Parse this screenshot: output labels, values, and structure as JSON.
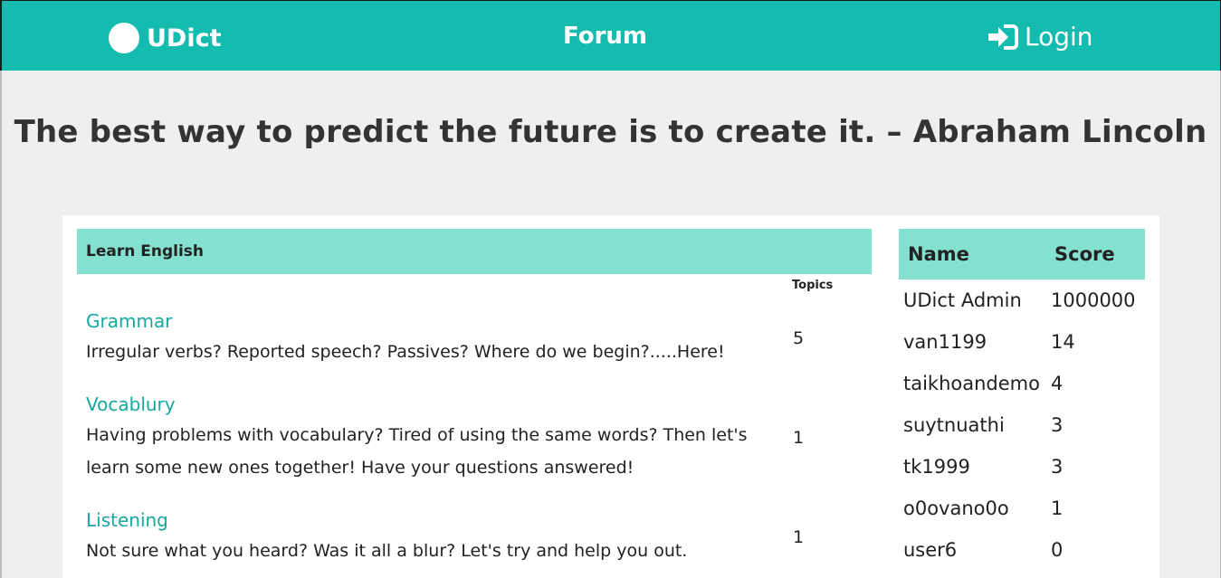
{
  "header": {
    "brand": "UDict",
    "forum_label": "Forum",
    "login_label": "Login"
  },
  "quote": "The best way to predict the future is to create it. – Abraham Lincoln",
  "category": {
    "title": "Learn English",
    "topics_header": "Topics",
    "forums": [
      {
        "title": "Grammar",
        "description": "Irregular verbs? Reported speech? Passives? Where do we begin?.....Here!",
        "topics": "5"
      },
      {
        "title": "Vocablury",
        "description_line1": "Having problems with vocabulary? Tired of using the same words? Then let's",
        "description_line2": "learn some new ones together! Have your questions answered!",
        "topics": "1"
      },
      {
        "title": "Listening",
        "description": "Not sure what you heard? Was it all a blur? Let's try and help you out.",
        "topics": "1"
      }
    ]
  },
  "leaderboard": {
    "name_header": "Name",
    "score_header": "Score",
    "rows": [
      {
        "name": "UDict Admin",
        "score": "1000000"
      },
      {
        "name": "van1199",
        "score": "14"
      },
      {
        "name": "taikhoandemo",
        "score": "4"
      },
      {
        "name": "suytnuathi",
        "score": "3"
      },
      {
        "name": "tk1999",
        "score": "3"
      },
      {
        "name": "o0ovano0o",
        "score": "1"
      },
      {
        "name": "user6",
        "score": "0"
      }
    ]
  },
  "colors": {
    "nav_bg": "#14bcb0",
    "accent_light": "#84e1d0",
    "link": "#17a99b",
    "page_bg": "#efefef"
  }
}
